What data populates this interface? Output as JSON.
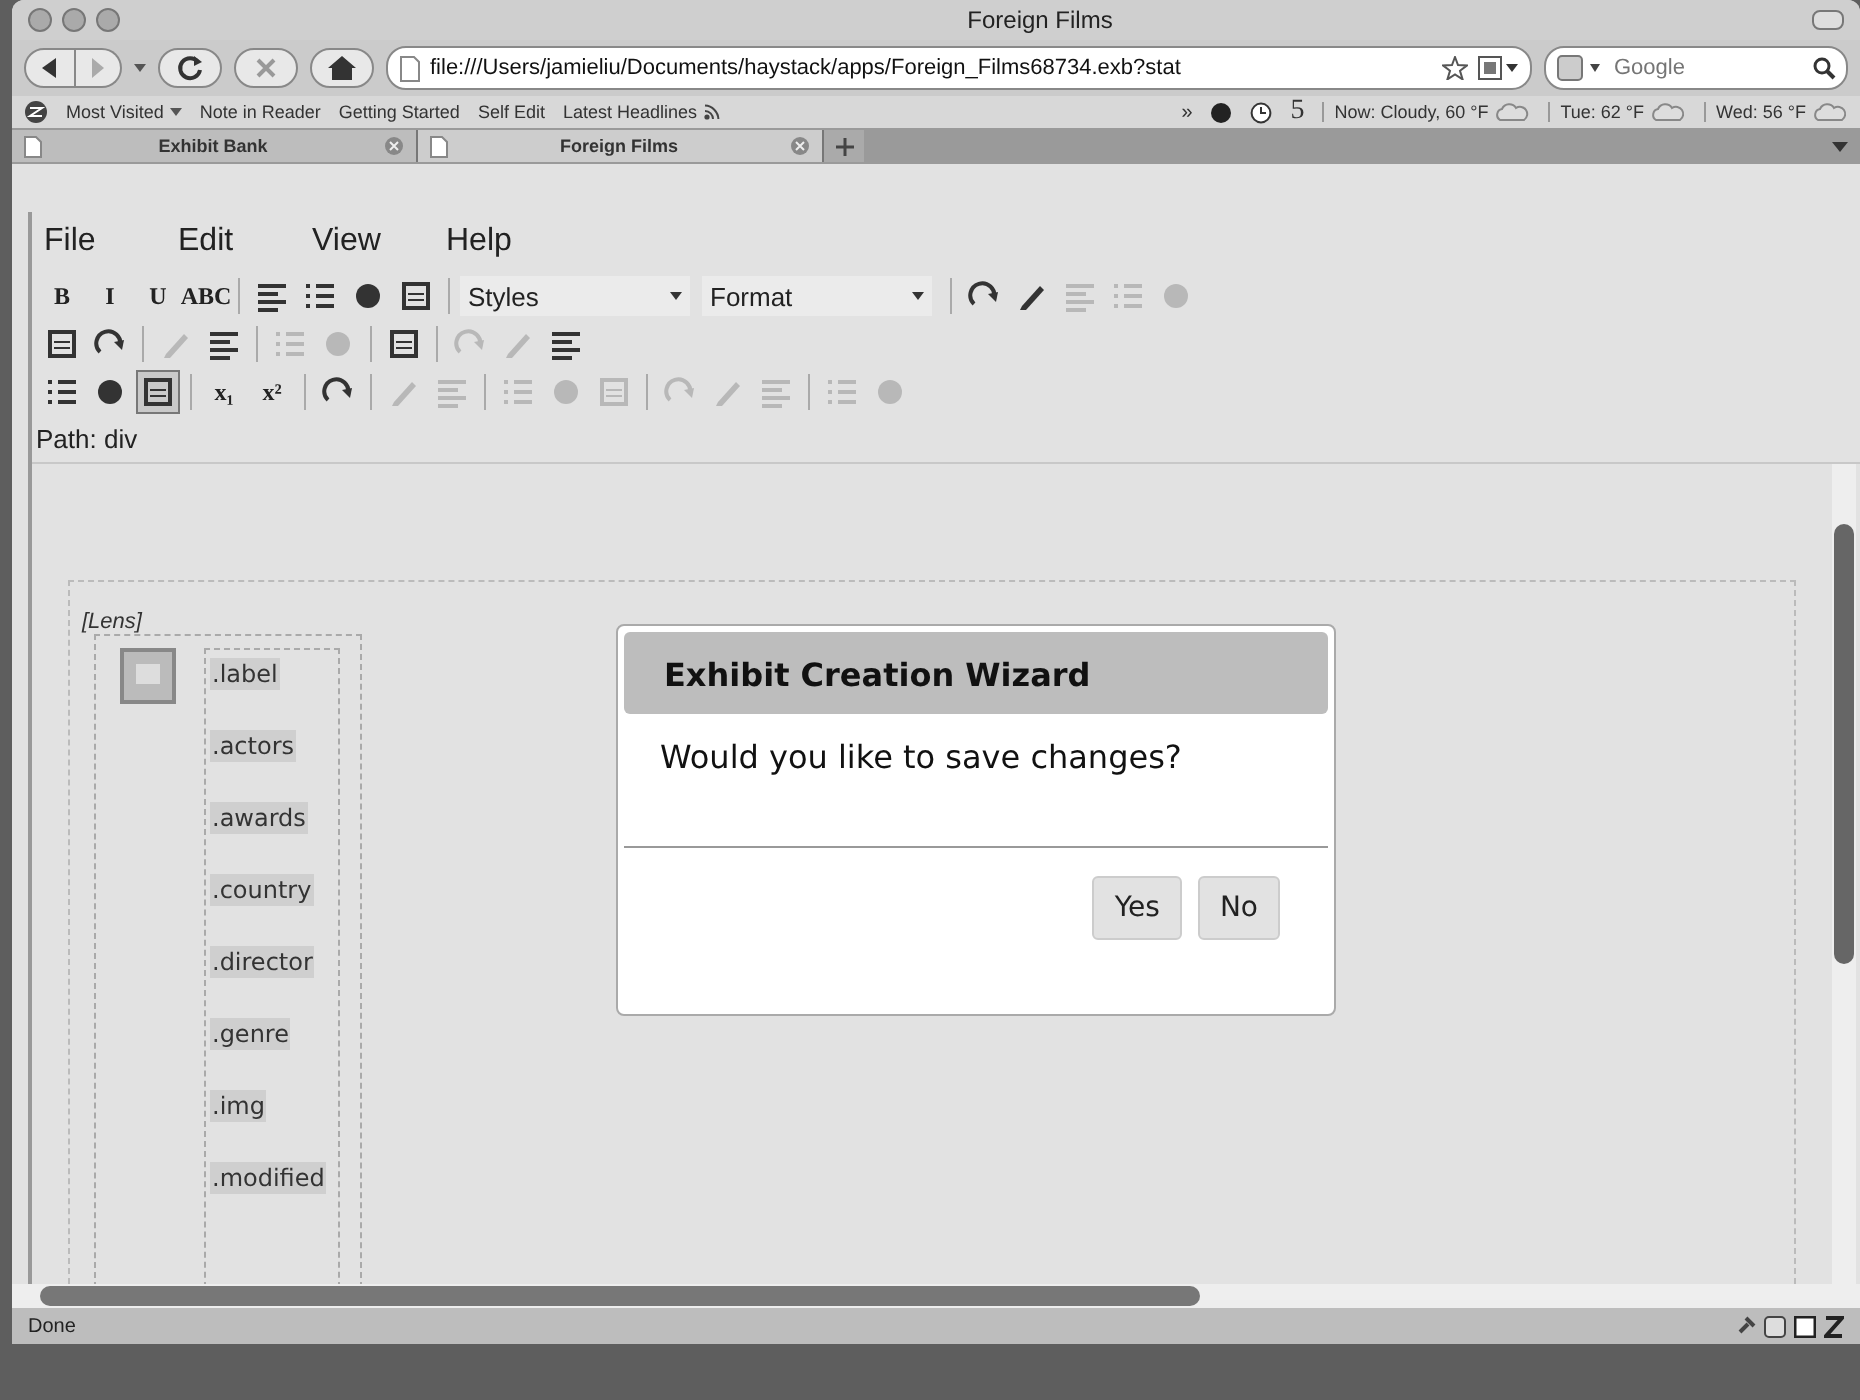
{
  "window": {
    "title": "Foreign Films"
  },
  "navigation": {
    "url": "file:///Users/jamieliu/Documents/haystack/apps/Foreign_Films68734.exb?stat",
    "search": {
      "placeholder": "Google"
    }
  },
  "bookmarks": [
    {
      "label": "Most Visited",
      "kind": "menu"
    },
    {
      "label": "Note in Reader",
      "kind": "link"
    },
    {
      "label": "Getting Started",
      "kind": "link"
    },
    {
      "label": "Self Edit",
      "kind": "link"
    },
    {
      "label": "Latest Headlines",
      "kind": "feed"
    }
  ],
  "bookmarks_overflow": "»",
  "weather": {
    "count": "5",
    "items": [
      {
        "text": "Now: Cloudy, 60 °F"
      },
      {
        "text": "Tue: 62 °F"
      },
      {
        "text": "Wed: 56 °F"
      }
    ]
  },
  "tabs": [
    {
      "label": "Exhibit Bank",
      "selected": false
    },
    {
      "label": "Foreign Films",
      "selected": true
    }
  ],
  "menu": [
    "File",
    "Edit",
    "View",
    "Help"
  ],
  "toolbar": [
    [
      {
        "kind": "text",
        "label": "B",
        "disabled": false,
        "pressed": false
      },
      {
        "kind": "text",
        "label": "I",
        "disabled": false,
        "pressed": false
      },
      {
        "kind": "text",
        "label": "U",
        "disabled": false,
        "pressed": false
      },
      {
        "kind": "text",
        "label": "ABC",
        "disabled": false,
        "pressed": false
      },
      {
        "kind": "separator"
      },
      {
        "kind": "icon",
        "disabled": false,
        "pressed": false
      },
      {
        "kind": "icon",
        "disabled": false,
        "pressed": false
      },
      {
        "kind": "icon",
        "disabled": false,
        "pressed": false
      },
      {
        "kind": "icon",
        "disabled": false,
        "pressed": false
      },
      {
        "kind": "separator"
      },
      {
        "kind": "select",
        "label": "Styles"
      },
      {
        "kind": "select",
        "label": "Format"
      },
      {
        "kind": "separator"
      },
      {
        "kind": "icon",
        "disabled": false,
        "pressed": false
      },
      {
        "kind": "icon",
        "disabled": false,
        "pressed": false
      },
      {
        "kind": "icon",
        "disabled": true,
        "pressed": false
      },
      {
        "kind": "icon",
        "disabled": true,
        "pressed": false
      },
      {
        "kind": "icon",
        "disabled": true,
        "pressed": false
      }
    ],
    [
      {
        "kind": "icon",
        "disabled": false,
        "pressed": false
      },
      {
        "kind": "icon",
        "disabled": false,
        "pressed": false
      },
      {
        "kind": "separator"
      },
      {
        "kind": "icon",
        "disabled": true,
        "pressed": false
      },
      {
        "kind": "icon",
        "disabled": false,
        "pressed": false
      },
      {
        "kind": "separator"
      },
      {
        "kind": "icon",
        "disabled": true,
        "pressed": false
      },
      {
        "kind": "icon",
        "disabled": true,
        "pressed": false
      },
      {
        "kind": "separator"
      },
      {
        "kind": "icon",
        "disabled": false,
        "pressed": false
      },
      {
        "kind": "separator"
      },
      {
        "kind": "icon",
        "disabled": true,
        "pressed": false
      },
      {
        "kind": "icon",
        "disabled": true,
        "pressed": false
      },
      {
        "kind": "icon",
        "disabled": false,
        "pressed": false
      }
    ],
    [
      {
        "kind": "icon",
        "disabled": false,
        "pressed": false
      },
      {
        "kind": "icon",
        "disabled": false,
        "pressed": false
      },
      {
        "kind": "icon",
        "disabled": false,
        "pressed": true
      },
      {
        "kind": "separator"
      },
      {
        "kind": "text",
        "label": "x₁",
        "disabled": false,
        "pressed": false
      },
      {
        "kind": "text",
        "label": "x²",
        "disabled": false,
        "pressed": false
      },
      {
        "kind": "separator"
      },
      {
        "kind": "icon",
        "disabled": false,
        "pressed": false
      },
      {
        "kind": "separator"
      },
      {
        "kind": "icon",
        "disabled": true,
        "pressed": false
      },
      {
        "kind": "icon",
        "disabled": true,
        "pressed": false
      },
      {
        "kind": "separator"
      },
      {
        "kind": "icon",
        "disabled": true,
        "pressed": false
      },
      {
        "kind": "icon",
        "disabled": true,
        "pressed": false
      },
      {
        "kind": "icon",
        "disabled": true,
        "pressed": false
      },
      {
        "kind": "separator"
      },
      {
        "kind": "icon",
        "disabled": true,
        "pressed": false
      },
      {
        "kind": "icon",
        "disabled": true,
        "pressed": false
      },
      {
        "kind": "icon",
        "disabled": true,
        "pressed": false
      },
      {
        "kind": "separator"
      },
      {
        "kind": "icon",
        "disabled": true,
        "pressed": false
      },
      {
        "kind": "icon",
        "disabled": true,
        "pressed": false
      }
    ]
  ],
  "path": "Path: div",
  "lens": {
    "title": "[Lens]",
    "fields": [
      ".label",
      ".actors",
      ".awards",
      ".country",
      ".director",
      ".genre",
      ".img",
      ".modified"
    ]
  },
  "dialog": {
    "title": "Exhibit Creation Wizard",
    "message": "Would you like to save changes?",
    "buttons": [
      "Yes",
      "No"
    ]
  },
  "status_bar": {
    "text": "Done"
  }
}
